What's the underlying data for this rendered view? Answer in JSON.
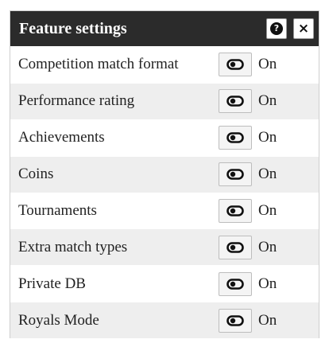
{
  "dialog": {
    "title": "Feature settings",
    "help_icon": "question-circle-icon",
    "help_glyph": "?",
    "close_icon": "close-icon",
    "close_glyph": "×"
  },
  "settings": [
    {
      "label": "Competition match format",
      "state": "On"
    },
    {
      "label": "Performance rating",
      "state": "On"
    },
    {
      "label": "Achievements",
      "state": "On"
    },
    {
      "label": "Coins",
      "state": "On"
    },
    {
      "label": "Tournaments",
      "state": "On"
    },
    {
      "label": "Extra match types",
      "state": "On"
    },
    {
      "label": "Private DB",
      "state": "On"
    },
    {
      "label": "Royals Mode",
      "state": "On"
    }
  ],
  "colors": {
    "header_bg": "#2b2b2b",
    "row_alt_bg": "#eeeeee"
  },
  "toggle_icon": "toggle-switch-icon"
}
